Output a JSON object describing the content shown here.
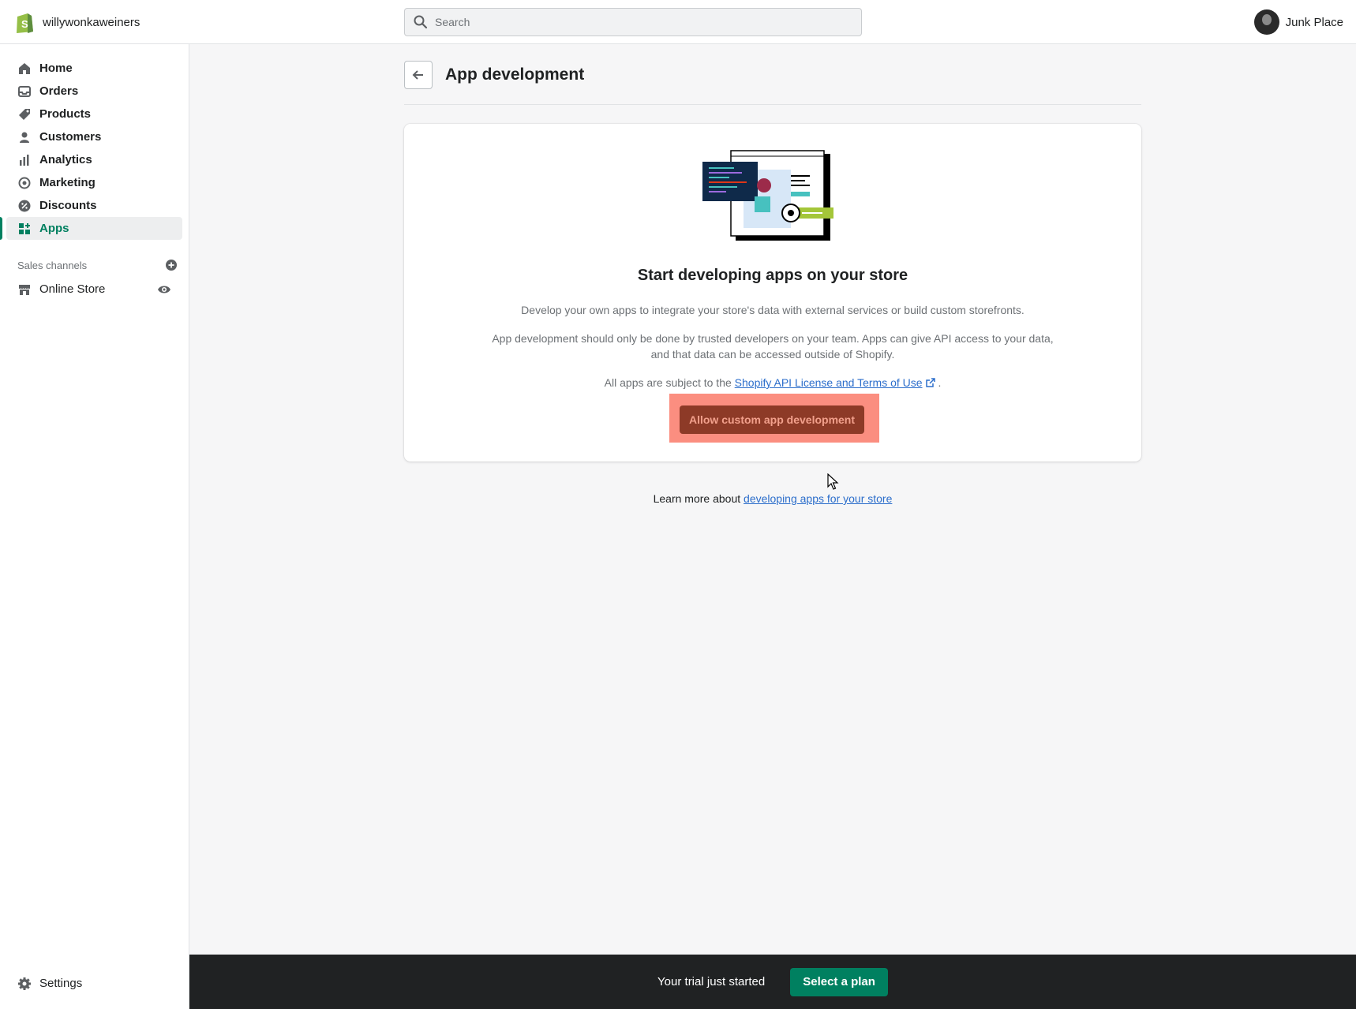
{
  "topbar": {
    "store_name": "willywonkaweiners",
    "search_placeholder": "Search",
    "user_name": "Junk Place"
  },
  "sidebar": {
    "items": [
      {
        "label": "Home",
        "icon": "home-icon"
      },
      {
        "label": "Orders",
        "icon": "inbox-icon"
      },
      {
        "label": "Products",
        "icon": "tag-icon"
      },
      {
        "label": "Customers",
        "icon": "person-icon"
      },
      {
        "label": "Analytics",
        "icon": "bar-chart-icon"
      },
      {
        "label": "Marketing",
        "icon": "target-icon"
      },
      {
        "label": "Discounts",
        "icon": "discount-icon"
      },
      {
        "label": "Apps",
        "icon": "apps-grid-icon",
        "active": true
      }
    ],
    "sales_channels_label": "Sales channels",
    "online_store_label": "Online Store",
    "settings_label": "Settings"
  },
  "page": {
    "title": "App development"
  },
  "card": {
    "heading": "Start developing apps on your store",
    "text1": "Develop your own apps to integrate your store's data with external services or build custom storefronts.",
    "text2": "App development should only be done by trusted developers on your team. Apps can give API access to your data, and that data can be accessed outside of Shopify.",
    "text3_prefix": "All apps are subject to the",
    "text3_link": "Shopify API License and Terms of Use",
    "text3_suffix": ".",
    "button_label": "Allow custom app development"
  },
  "learn_more": {
    "prefix": "Learn more about",
    "link": "developing apps for your store"
  },
  "trial": {
    "text": "Your trial just started",
    "button_label": "Select a plan"
  },
  "colors": {
    "accent": "#008060",
    "highlight": "#fb8e80",
    "button": "#8d3a27",
    "link": "#2c6ecb"
  }
}
